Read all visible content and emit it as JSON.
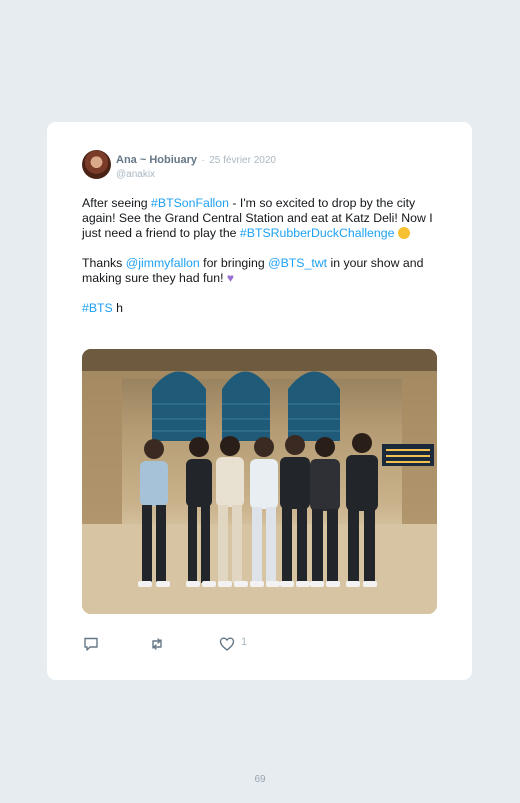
{
  "tweet": {
    "author_name": "Ana ~ Hobiuary",
    "separator": "·",
    "date": "25 février 2020",
    "handle": "@anakix",
    "p1_a": "After seeing ",
    "p1_link1": "#BTSonFallon",
    "p1_b": " - I'm so excited to drop by the city again! See the Grand Central Station and eat at Katz Deli! Now I just need a friend to play the ",
    "p1_link2": "#BTSRubberDuckChallenge",
    "p2_a": "Thanks ",
    "p2_link1": "@jimmyfallon",
    "p2_b": " for bringing ",
    "p2_link2": "@BTS_twt",
    "p2_c": " in your show and making sure they had fun! ",
    "p3_link": "#BTS",
    "p3_tail": " h",
    "emoji_laugh": "rolling-on-floor-laughing-emoji",
    "emoji_heart": "purple-heart-emoji",
    "like_count": "1"
  },
  "icons": {
    "reply": "reply-icon",
    "retweet": "retweet-icon",
    "like": "heart-icon"
  },
  "colors": {
    "background": "#e6ecf0",
    "card": "#ffffff",
    "link": "#1da1f2",
    "muted": "#aab8c2"
  },
  "page_number": "69"
}
